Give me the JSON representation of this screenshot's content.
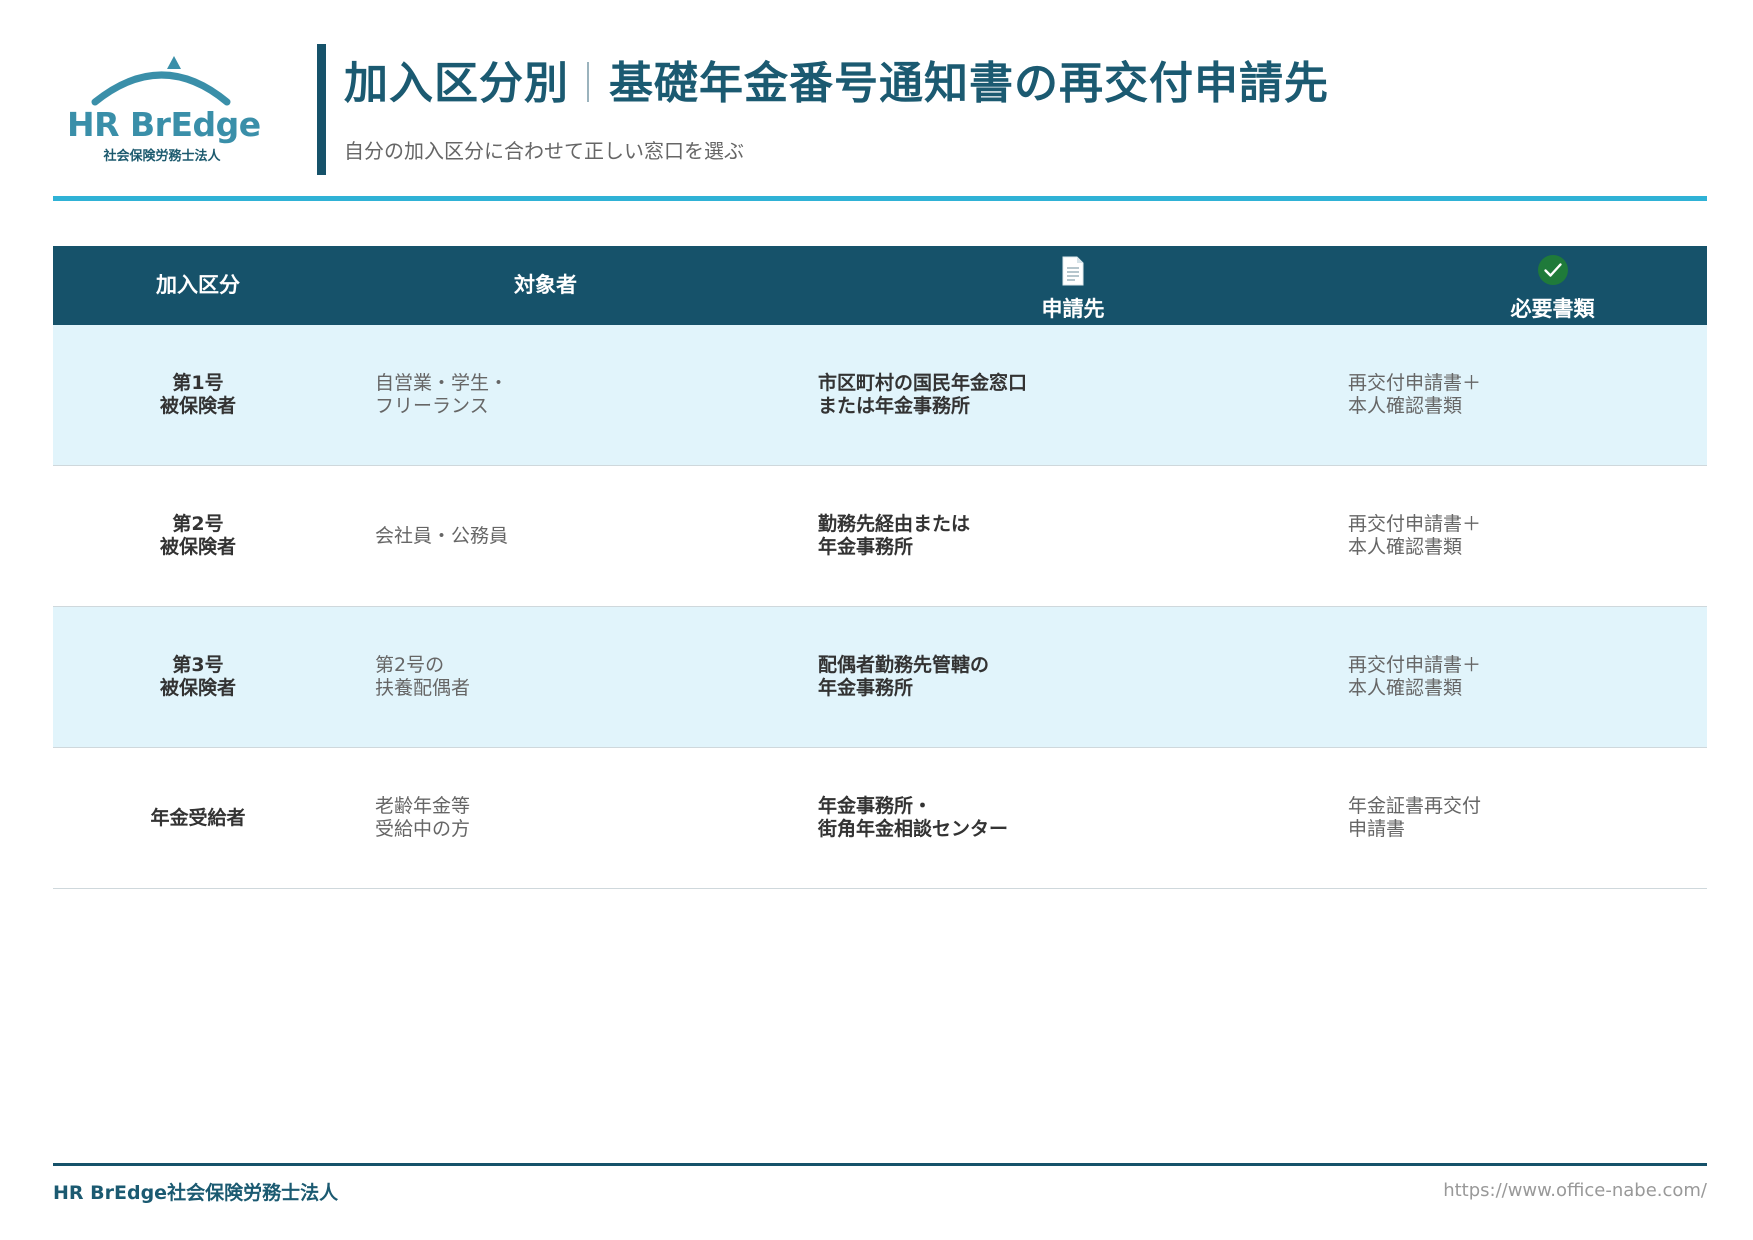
{
  "header": {
    "logo": {
      "name": "HR BrEdge",
      "subtitle": "社会保険労務士法人"
    },
    "title_left": "加入区分別",
    "title_right": "基礎年金番号通知書の再交付申請先",
    "subtitle": "自分の加入区分に合わせて正しい窓口を選ぶ",
    "accent_color": "#2fb2d6",
    "brand_color": "#16526a"
  },
  "table": {
    "headers": {
      "category": "加入区分",
      "target": "対象者",
      "destination": "申請先",
      "documents": "必要書類"
    },
    "header_icons": {
      "destination": "document-icon",
      "documents": "check-circle-icon"
    },
    "rows": [
      {
        "category": [
          "第1号",
          "被保険者"
        ],
        "target": [
          "自営業・学生・",
          "フリーランス"
        ],
        "destination": [
          "市区町村の国民年金窓口",
          "または年金事務所"
        ],
        "documents": [
          "再交付申請書＋",
          "本人確認書類"
        ]
      },
      {
        "category": [
          "第2号",
          "被保険者"
        ],
        "target": [
          "会社員・公務員"
        ],
        "destination": [
          "勤務先経由または",
          "年金事務所"
        ],
        "documents": [
          "再交付申請書＋",
          "本人確認書類"
        ]
      },
      {
        "category": [
          "第3号",
          "被保険者"
        ],
        "target": [
          "第2号の",
          "扶養配偶者"
        ],
        "destination": [
          "配偶者勤務先管轄の",
          "年金事務所"
        ],
        "documents": [
          "再交付申請書＋",
          "本人確認書類"
        ]
      },
      {
        "category": [
          "年金受給者"
        ],
        "target": [
          "老齢年金等",
          "受給中の方"
        ],
        "destination": [
          "年金事務所・",
          "街角年金相談センター"
        ],
        "documents": [
          "年金証書再交付",
          "申請書"
        ]
      }
    ]
  },
  "footer": {
    "left": "HR BrEdge社会保険労務士法人",
    "right": "https://www.office-nabe.com/"
  }
}
